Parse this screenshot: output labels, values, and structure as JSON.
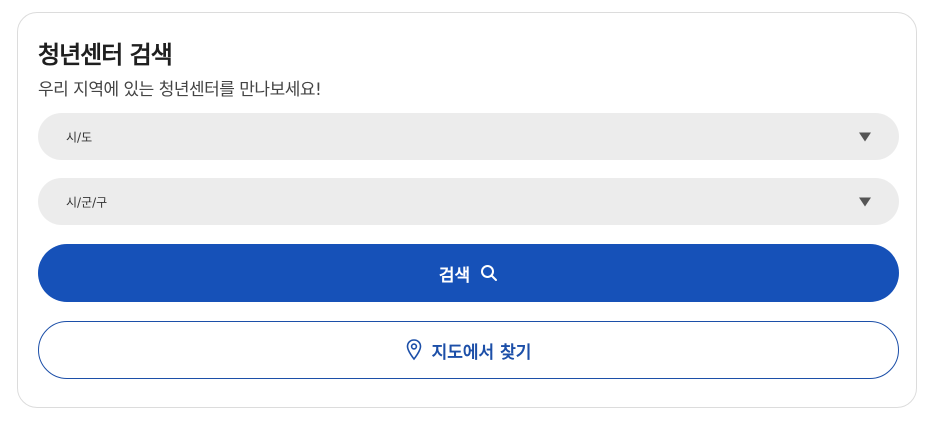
{
  "header": {
    "title": "청년센터 검색",
    "subtitle": "우리 지역에 있는 청년센터를 만나보세요!"
  },
  "filters": {
    "region": {
      "selected": "시/도",
      "icon": "caret-down-icon"
    },
    "district": {
      "selected": "시/군/구",
      "icon": "caret-down-icon"
    }
  },
  "actions": {
    "search_label": "검색",
    "search_icon": "search-icon",
    "map_label": "지도에서 찾기",
    "map_icon": "map-pin-icon"
  },
  "colors": {
    "primary": "#1651b8",
    "outline": "#1c4fa8",
    "select_bg": "#ececec"
  }
}
